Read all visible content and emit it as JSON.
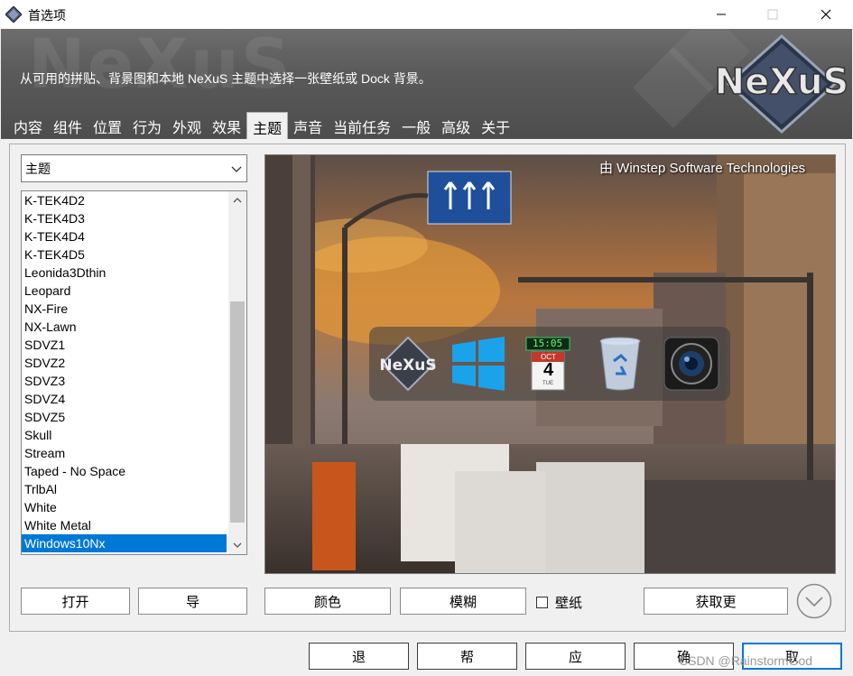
{
  "window": {
    "title": "首选项",
    "controls": {
      "minimize": "minimize-icon",
      "maximize": "maximize-icon",
      "close": "close-icon"
    }
  },
  "banner": {
    "description": "从可用的拼贴、背景图和本地 NeXuS 主题中选择一张壁纸或 Dock 背景。",
    "logo_text": "NeXuS"
  },
  "tabs": [
    {
      "label": "内容",
      "active": false
    },
    {
      "label": "组件",
      "active": false
    },
    {
      "label": "位置",
      "active": false
    },
    {
      "label": "行为",
      "active": false
    },
    {
      "label": "外观",
      "active": false
    },
    {
      "label": "效果",
      "active": false
    },
    {
      "label": "主题",
      "active": true
    },
    {
      "label": "声音",
      "active": false
    },
    {
      "label": "当前任务",
      "active": false
    },
    {
      "label": "一般",
      "active": false
    },
    {
      "label": "高级",
      "active": false
    },
    {
      "label": "关于",
      "active": false
    }
  ],
  "category_select": {
    "value": "主题"
  },
  "theme_list": {
    "items": [
      "K-TEK4D2",
      "K-TEK4D3",
      "K-TEK4D4",
      "K-TEK4D5",
      "Leonida3Dthin",
      "Leopard",
      "NX-Fire",
      "NX-Lawn",
      "SDVZ1",
      "SDVZ2",
      "SDVZ3",
      "SDVZ4",
      "SDVZ5",
      "Skull",
      "Stream",
      "Taped - No Space",
      "TrlbAl",
      "White",
      "White Metal",
      "Windows10Nx"
    ],
    "selected": "Windows10Nx"
  },
  "preview": {
    "caption": "由 Winstep Software Technologies",
    "dock_icons": [
      "nexus-logo-icon",
      "windows-logo-icon",
      "clock-calendar-icon",
      "recycle-bin-icon",
      "camera-lens-icon"
    ],
    "clock_time": "15:05",
    "calendar_month": "OCT",
    "calendar_day": "4",
    "calendar_weekday": "TUE"
  },
  "buttons": {
    "open": "打开",
    "export": "导",
    "color": "颜色",
    "blur": "模糊",
    "wallpaper_checkbox": "壁纸",
    "wallpaper_checked": false,
    "get_more": "获取更",
    "ok": "退",
    "help": "帮",
    "apply": "应",
    "confirm": "确",
    "cancel": "取"
  },
  "watermark": "CSDN @RainstormGod",
  "colors": {
    "selection": "#0078d7",
    "banner": "#5a5a5a",
    "panel": "#f0f0f0"
  }
}
